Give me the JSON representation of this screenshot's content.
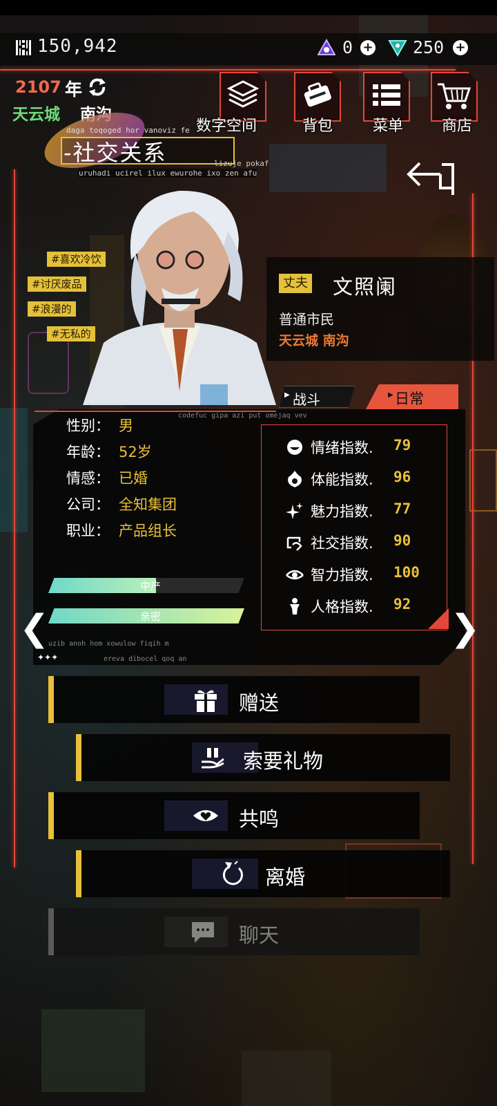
{
  "currency": {
    "money_icon": "barcode-coin-icon",
    "money": "150,942",
    "gem_a": "0",
    "gem_a_icon": "tri-gem-icon",
    "gem_b": "250",
    "gem_b_icon": "v-gem-icon"
  },
  "header": {
    "year": "2107",
    "year_suffix": "年",
    "city": "天云城",
    "district": "南沟"
  },
  "nav": {
    "digital_space": "数字空间",
    "backpack": "背包",
    "menu": "菜单",
    "shop": "商店"
  },
  "title": {
    "text": "-社交关系",
    "small": "daga toqoged hor vanoviz fe",
    "sub1": "lizuje pokaf",
    "sub2": "uruhadi ucirel ilux ewurohe ixo zen afu"
  },
  "tags": [
    "#喜欢冷饮",
    "#讨厌废品",
    "#浪漫的",
    "#无私的"
  ],
  "character": {
    "role": "丈夫",
    "name": "文照阑",
    "class": "普通市民",
    "home": "天云城 南沟"
  },
  "tabs": {
    "combat": "战斗",
    "daily": "日常",
    "active": "daily"
  },
  "info": {
    "watermark": "codefuc gipa azi put omejaq vev",
    "rows": [
      {
        "label": "性别：",
        "value": "男"
      },
      {
        "label": "年龄：",
        "value": "52岁"
      },
      {
        "label": "情感：",
        "value": "已婚"
      },
      {
        "label": "公司：",
        "value": "全知集团"
      },
      {
        "label": "职业：",
        "value": "产品组长"
      }
    ],
    "bars": [
      {
        "label": "中产",
        "fill": 0.55
      },
      {
        "label": "亲密",
        "fill": 1.0
      }
    ],
    "footer1": "uzib anoh hom xowulow fiqih m",
    "footer2": "ereva dibocel qoq an",
    "stars": "✦✦✦"
  },
  "stats": [
    {
      "icon": "mood-icon",
      "label": "情绪指数.",
      "value": "79"
    },
    {
      "icon": "fitness-icon",
      "label": "体能指数.",
      "value": "96"
    },
    {
      "icon": "sparkle-icon",
      "label": "魅力指数.",
      "value": "77"
    },
    {
      "icon": "social-icon",
      "label": "社交指数.",
      "value": "90"
    },
    {
      "icon": "eye-icon",
      "label": "智力指数.",
      "value": "100"
    },
    {
      "icon": "person-icon",
      "label": "人格指数.",
      "value": "92"
    }
  ],
  "actions": {
    "gift": "赠送",
    "ask_gift": "索要礼物",
    "resonate": "共鸣",
    "divorce": "离婚",
    "chat": "聊天"
  },
  "colors": {
    "accent_red": "#e2473a",
    "accent_yellow": "#e8c03a",
    "city_green": "#6ddc7a",
    "daily_tab": "#e8553e"
  }
}
